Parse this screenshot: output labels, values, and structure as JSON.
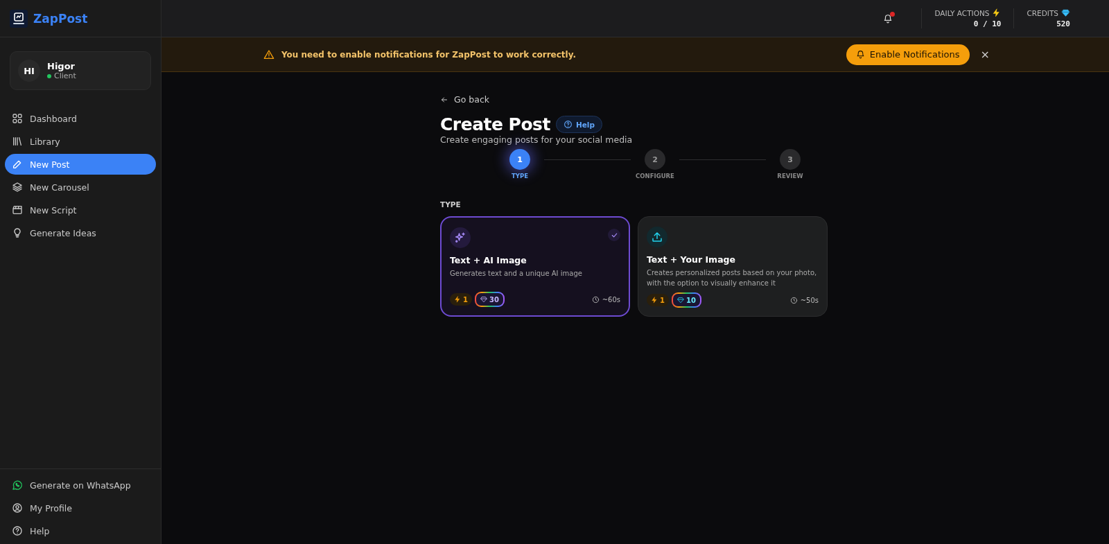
{
  "brand": {
    "name": "ZapPost"
  },
  "user": {
    "initials": "HI",
    "name": "Higor",
    "role": "Client",
    "online": true
  },
  "sidebar": {
    "items": [
      {
        "label": "Dashboard",
        "selected": false
      },
      {
        "label": "Library",
        "selected": false
      },
      {
        "label": "New Post",
        "selected": true
      },
      {
        "label": "New Carousel",
        "selected": false
      },
      {
        "label": "New Script",
        "selected": false
      },
      {
        "label": "Generate Ideas",
        "selected": false
      }
    ],
    "footer_items": [
      {
        "label": "Generate on WhatsApp"
      },
      {
        "label": "My Profile"
      },
      {
        "label": "Help"
      }
    ]
  },
  "topbar": {
    "has_unread": true,
    "daily_actions": {
      "label": "DAILY ACTIONS",
      "value": "0 / 10"
    },
    "credits": {
      "label": "CREDITS",
      "value": "520"
    }
  },
  "banner": {
    "message": "You need to enable notifications for ZapPost to work correctly.",
    "button": "Enable Notifications",
    "close": "×"
  },
  "page": {
    "back": "Go back",
    "title": "Create Post",
    "help": "Help",
    "subtitle": "Create engaging posts for your social media"
  },
  "steps": [
    {
      "number": "1",
      "label": "TYPE",
      "selected": true
    },
    {
      "number": "2",
      "label": "CONFIGURE",
      "selected": false
    },
    {
      "number": "3",
      "label": "REVIEW",
      "selected": false
    }
  ],
  "section_label": "TYPE",
  "types": [
    {
      "title": "Text + AI Image",
      "description": "Generates text and a unique AI image",
      "actions": "1",
      "credits": "30",
      "time": "~60s",
      "selected": true
    },
    {
      "title": "Text + Your Image",
      "description": "Creates personalized posts based on your photo, with the option to visually enhance it",
      "actions": "1",
      "credits": "10",
      "time": "~50s",
      "selected": false
    }
  ]
}
